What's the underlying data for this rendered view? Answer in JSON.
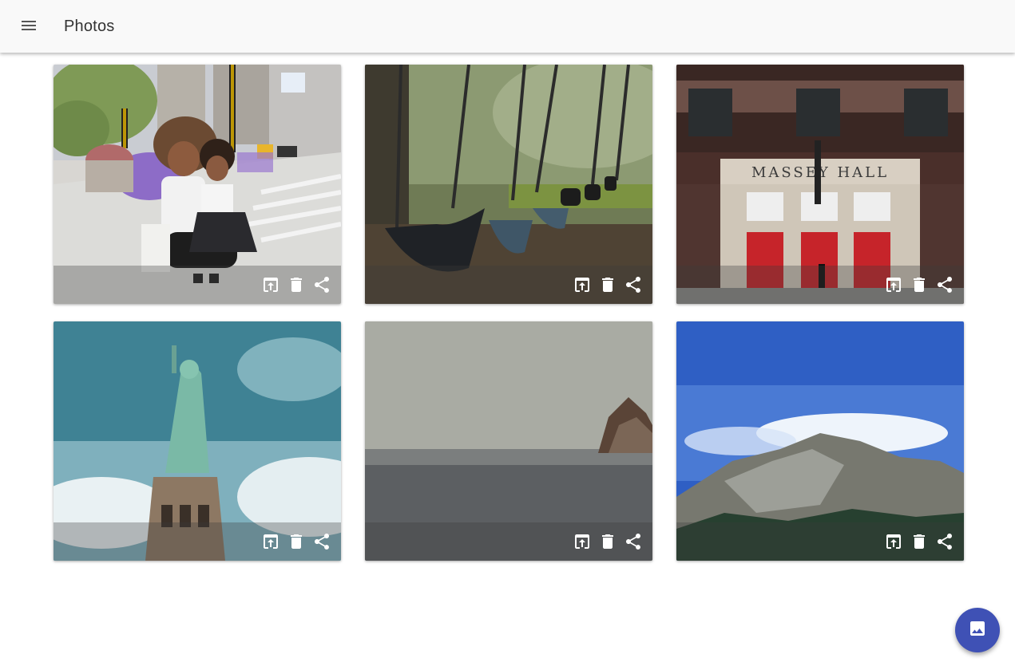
{
  "appbar": {
    "title": "Photos",
    "menu_icon": "menu-icon",
    "background": "#f9f9f9"
  },
  "photos": [
    {
      "subject": "mother-and-daughter-city-street",
      "actions": [
        "open-in-icon",
        "delete-icon",
        "share-icon"
      ]
    },
    {
      "subject": "playground-swings",
      "actions": [
        "open-in-icon",
        "delete-icon",
        "share-icon"
      ]
    },
    {
      "subject": "massey-hall-building",
      "sign_text": "MASSEY HALL",
      "actions": [
        "open-in-icon",
        "delete-icon",
        "share-icon"
      ]
    },
    {
      "subject": "statue-of-liberty",
      "actions": [
        "open-in-icon",
        "delete-icon",
        "share-icon"
      ]
    },
    {
      "subject": "foggy-sea-rock",
      "actions": [
        "open-in-icon",
        "delete-icon",
        "share-icon"
      ]
    },
    {
      "subject": "mountain-landscape",
      "actions": [
        "open-in-icon",
        "delete-icon",
        "share-icon"
      ]
    }
  ],
  "fab": {
    "icon": "image-icon",
    "color": "#3f51b5"
  }
}
